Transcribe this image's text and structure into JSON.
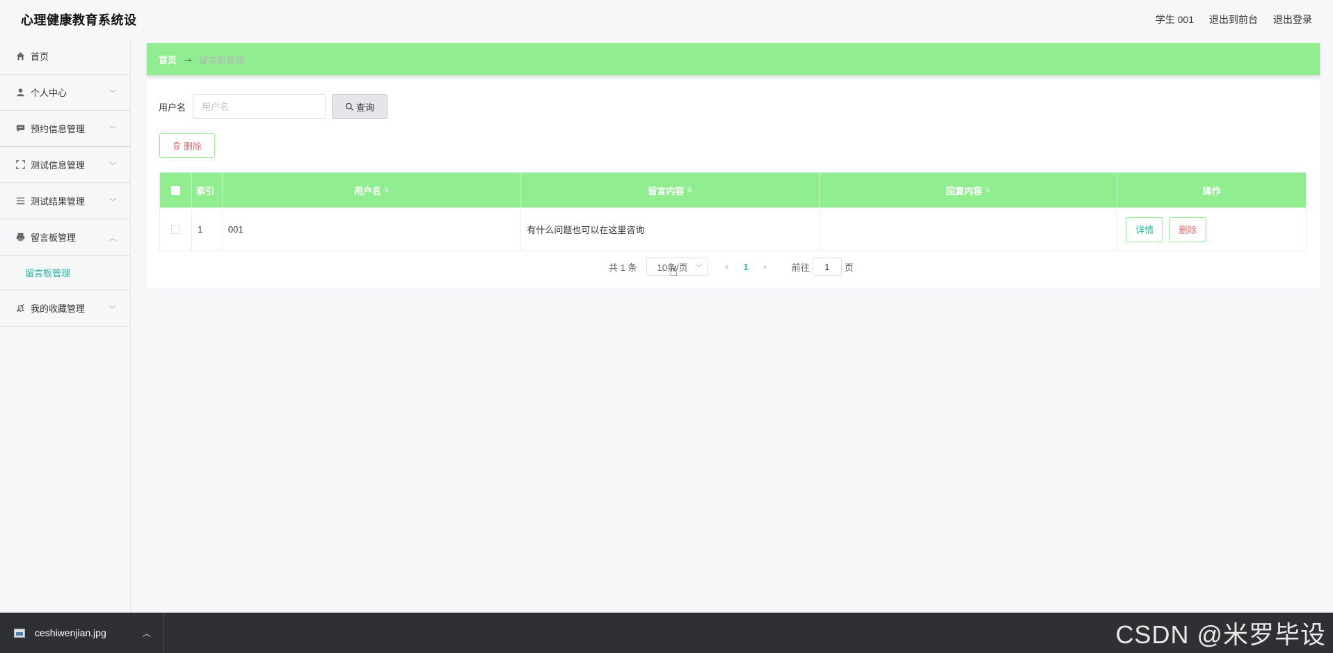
{
  "header": {
    "title": "心理健康教育系统设",
    "user": "学生 001",
    "to_front": "退出到前台",
    "logout": "退出登录"
  },
  "sidebar": {
    "items": [
      {
        "label": "首页",
        "icon": "home-icon"
      },
      {
        "label": "个人中心",
        "icon": "user-icon"
      },
      {
        "label": "预约信息管理",
        "icon": "chat-icon"
      },
      {
        "label": "测试信息管理",
        "icon": "fullscreen-icon"
      },
      {
        "label": "测试结果管理",
        "icon": "menu-lines-icon"
      },
      {
        "label": "留言板管理",
        "icon": "printer-icon"
      },
      {
        "label": "我的收藏管理",
        "icon": "bell-off-icon"
      }
    ],
    "submenu_label": "留言板管理"
  },
  "breadcrumb": {
    "home": "首页",
    "arrow": "→",
    "current": "留言板管理"
  },
  "search": {
    "label": "用户名",
    "placeholder": "用户名",
    "button": "查询"
  },
  "toolbar": {
    "delete_label": "删除"
  },
  "table": {
    "headers": [
      "索引",
      "用户名",
      "留言内容",
      "回复内容",
      "操作"
    ],
    "rows": [
      {
        "index": "1",
        "username": "001",
        "message": "有什么问题也可以在这里咨询",
        "reply": ""
      }
    ],
    "detail_label": "详情",
    "delete_label": "删除"
  },
  "pagination": {
    "total": "共 1 条",
    "page_size": "10条/页",
    "current_page": "1",
    "goto_label": "前往",
    "goto_value": "1",
    "page_suffix": "页"
  },
  "download_bar": {
    "filename": "ceshiwenjian.jpg"
  },
  "watermark": "CSDN @米罗毕设",
  "colors": {
    "accent_green": "#90ee90",
    "teal": "#26b5a7",
    "danger": "#e86b6b"
  }
}
